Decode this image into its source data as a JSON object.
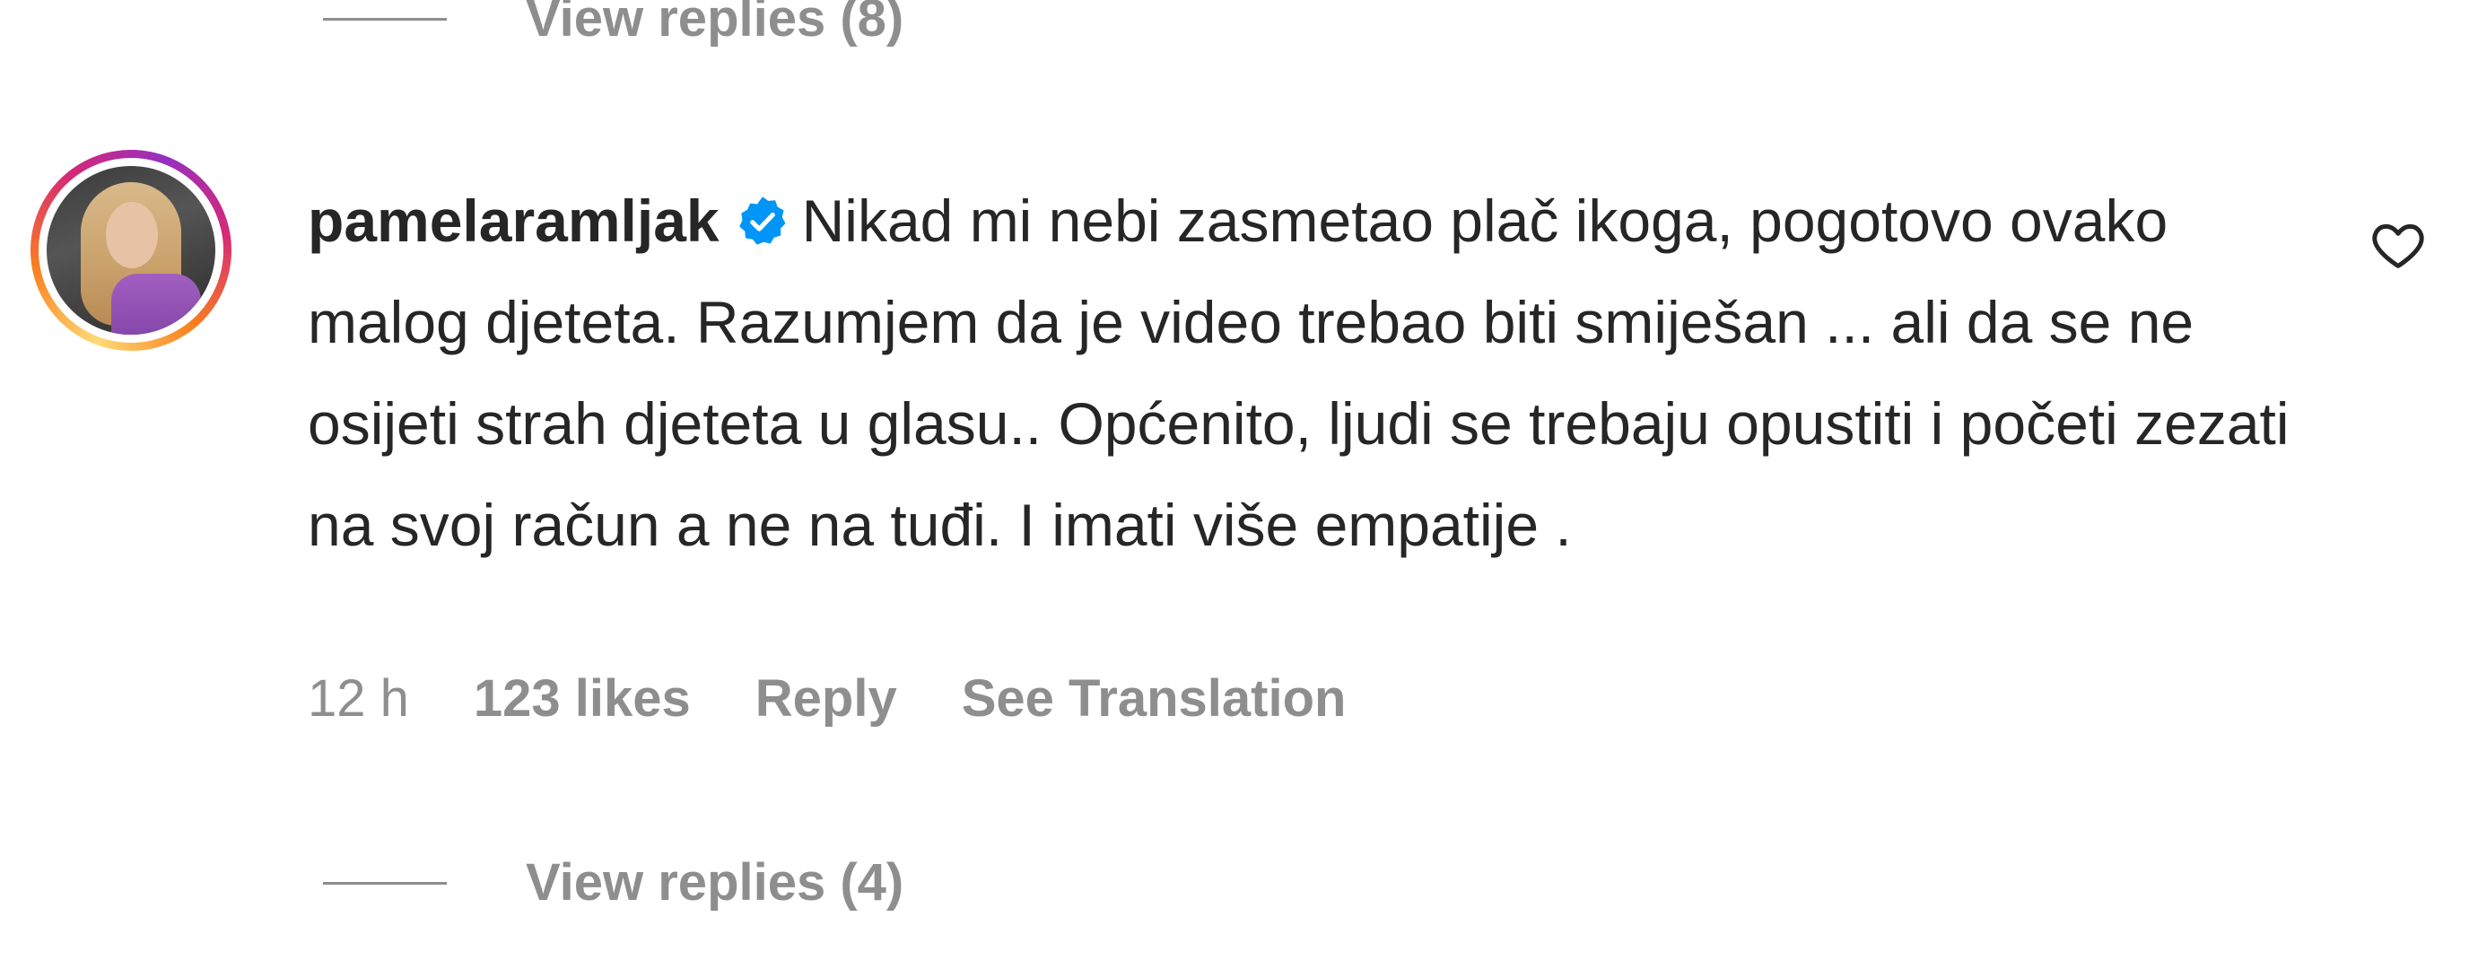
{
  "replies_top": {
    "label": "View replies (8)"
  },
  "comment": {
    "username": "pamelaramljak",
    "verified": true,
    "text": "Nikad mi nebi zasmetao plač ikoga, pogotovo ovako malog djeteta. Razumjem da je video trebao biti smiješan ... ali da se ne osijeti strah djeteta u glasu.. Općenito, ljudi se trebaju opustiti i početi zezati na svoj račun a ne na tuđi. I imati više empatije .",
    "time": "12 h",
    "likes": "123 likes",
    "reply_label": "Reply",
    "translate_label": "See Translation",
    "icons": {
      "avatar": "avatar-photo",
      "verified": "verified-badge-icon",
      "like": "heart-outline-icon"
    }
  },
  "replies_bottom": {
    "label": "View replies (4)"
  },
  "colors": {
    "text": "#262626",
    "secondary": "#8e8e8e",
    "verified_blue": "#0095f6",
    "background": "#ffffff"
  }
}
